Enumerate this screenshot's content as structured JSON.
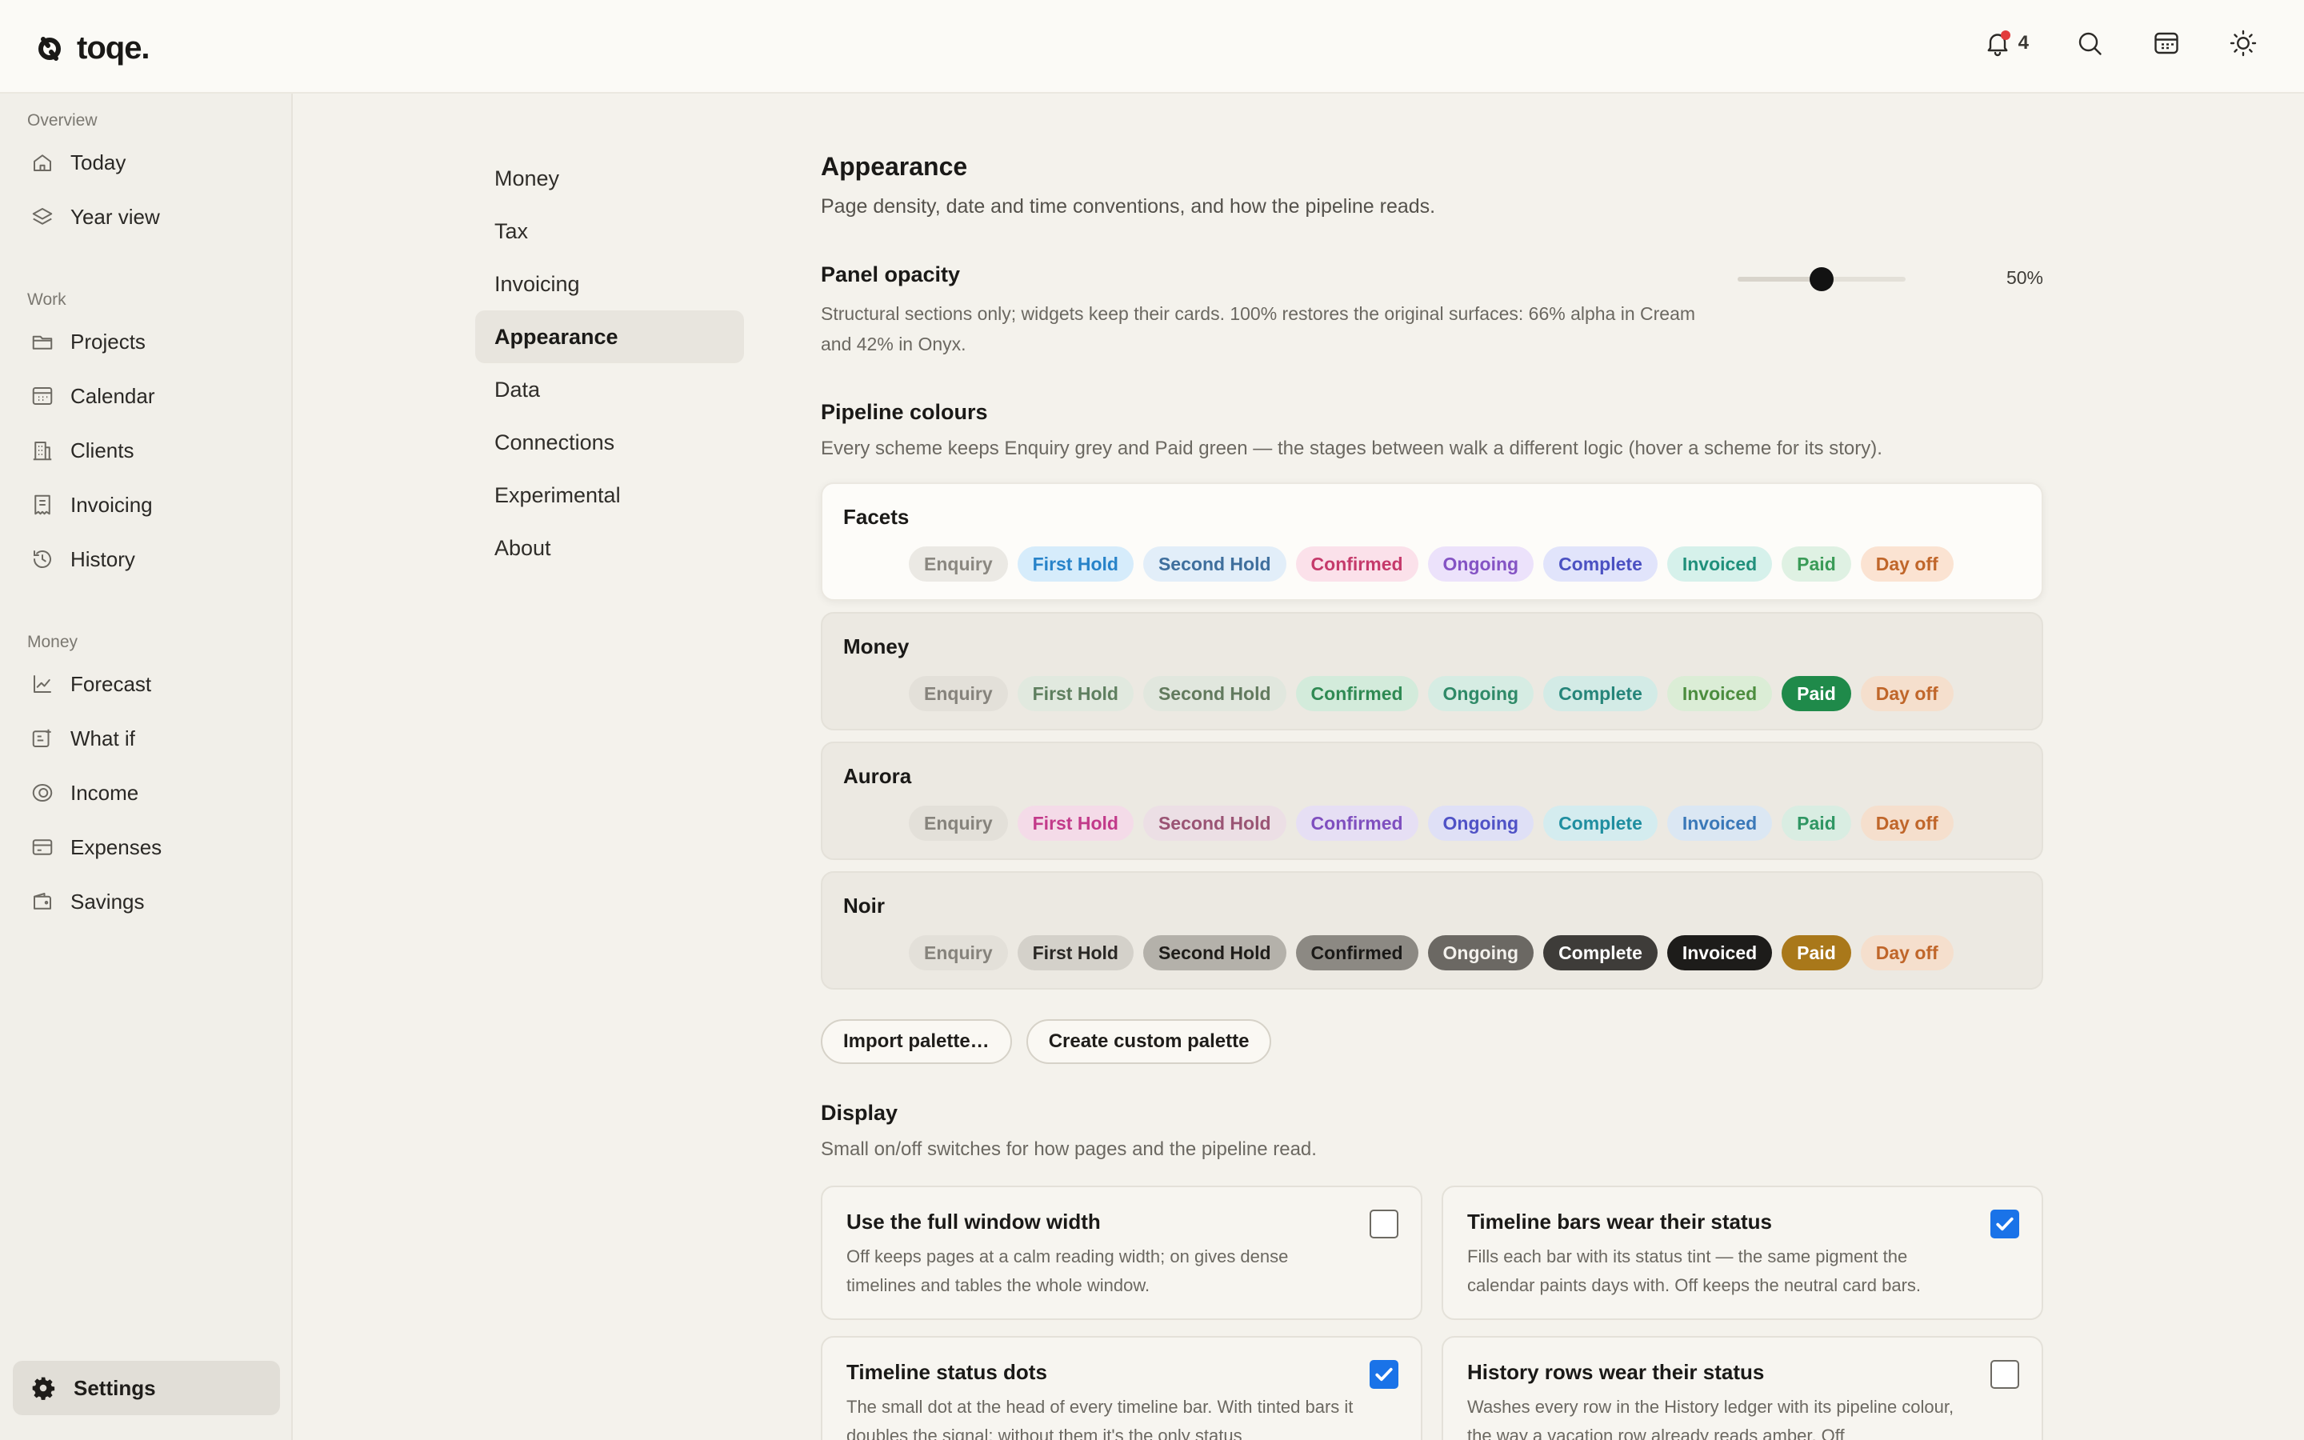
{
  "app": {
    "name": "toqe."
  },
  "topbar": {
    "notifications_count": "4"
  },
  "sidebar": {
    "sections": [
      {
        "heading": "Overview",
        "items": [
          {
            "label": "Today",
            "icon": "home-icon"
          },
          {
            "label": "Year view",
            "icon": "layers-icon"
          }
        ]
      },
      {
        "heading": "Work",
        "items": [
          {
            "label": "Projects",
            "icon": "folder-icon"
          },
          {
            "label": "Calendar",
            "icon": "calendar-icon"
          },
          {
            "label": "Clients",
            "icon": "building-icon"
          },
          {
            "label": "Invoicing",
            "icon": "invoice-icon"
          },
          {
            "label": "History",
            "icon": "history-icon"
          }
        ]
      },
      {
        "heading": "Money",
        "items": [
          {
            "label": "Forecast",
            "icon": "chart-line-icon"
          },
          {
            "label": "What if",
            "icon": "scenario-icon"
          },
          {
            "label": "Income",
            "icon": "coin-icon"
          },
          {
            "label": "Expenses",
            "icon": "card-icon"
          },
          {
            "label": "Savings",
            "icon": "wallet-icon"
          }
        ]
      }
    ],
    "settings_label": "Settings"
  },
  "subnav": {
    "items": [
      "Money",
      "Tax",
      "Invoicing",
      "Appearance",
      "Data",
      "Connections",
      "Experimental",
      "About"
    ],
    "active": "Appearance"
  },
  "appearance": {
    "title": "Appearance",
    "subtitle": "Page density, date and time conventions, and how the pipeline reads.",
    "opacity": {
      "label": "Panel opacity",
      "description": "Structural sections only; widgets keep their cards. 100% restores the original surfaces: 66% alpha in Cream and 42% in Onyx.",
      "value": 50,
      "value_label": "50%"
    },
    "pipeline": {
      "title": "Pipeline colours",
      "subtitle": "Every scheme keeps Enquiry grey and Paid green — the stages between walk a different logic (hover a scheme for its story).",
      "stages": [
        "Enquiry",
        "First Hold",
        "Second Hold",
        "Confirmed",
        "Ongoing",
        "Complete",
        "Invoiced",
        "Paid",
        "Day off"
      ],
      "schemes": [
        {
          "name": "Facets",
          "active": true,
          "chips": [
            {
              "bg": "#ebe9e4",
              "fg": "#8a8780"
            },
            {
              "bg": "#d6ecfb",
              "fg": "#2783c9"
            },
            {
              "bg": "#e2eef9",
              "fg": "#3f6f9d"
            },
            {
              "bg": "#fbe1ea",
              "fg": "#c53a6b"
            },
            {
              "bg": "#ece2fb",
              "fg": "#8453c4"
            },
            {
              "bg": "#e1e4fb",
              "fg": "#4b51c2"
            },
            {
              "bg": "#d6f1eb",
              "fg": "#20907b"
            },
            {
              "bg": "#dff1e3",
              "fg": "#3a9b57"
            },
            {
              "bg": "#fbe3d2",
              "fg": "#c0662a"
            }
          ]
        },
        {
          "name": "Money",
          "active": false,
          "chips": [
            {
              "bg": "#e3e0d9",
              "fg": "#86837c"
            },
            {
              "bg": "#e1e9df",
              "fg": "#5e7f5f"
            },
            {
              "bg": "#e1e7de",
              "fg": "#627a5e"
            },
            {
              "bg": "#d3ebdb",
              "fg": "#2f8a53"
            },
            {
              "bg": "#d6ece3",
              "fg": "#2f8a68"
            },
            {
              "bg": "#d3ebe6",
              "fg": "#26857a"
            },
            {
              "bg": "#dbedd6",
              "fg": "#4c8d3e"
            },
            {
              "bg": "#1f8a4a",
              "fg": "#ffffff"
            },
            {
              "bg": "#f5dfcd",
              "fg": "#c0662a"
            }
          ]
        },
        {
          "name": "Aurora",
          "active": false,
          "chips": [
            {
              "bg": "#e3e0d9",
              "fg": "#86837c"
            },
            {
              "bg": "#f4dbe8",
              "fg": "#c23a8a"
            },
            {
              "bg": "#ecdfe5",
              "fg": "#9a5474"
            },
            {
              "bg": "#e6dff4",
              "fg": "#7f4fbf"
            },
            {
              "bg": "#dfe0f6",
              "fg": "#4f52c6"
            },
            {
              "bg": "#d4ecef",
              "fg": "#1f8ea0"
            },
            {
              "bg": "#dbe7f3",
              "fg": "#3a78b8"
            },
            {
              "bg": "#d9ede2",
              "fg": "#2f9663"
            },
            {
              "bg": "#f5dfcd",
              "fg": "#c0662a"
            }
          ]
        },
        {
          "name": "Noir",
          "active": false,
          "chips": [
            {
              "bg": "#e3e0d9",
              "fg": "#86837c"
            },
            {
              "bg": "#d4d1ca",
              "fg": "#2a2825"
            },
            {
              "bg": "#b4b1aa",
              "fg": "#1f1d1a"
            },
            {
              "bg": "#8c8983",
              "fg": "#1a1917"
            },
            {
              "bg": "#6b6863",
              "fg": "#f3f1ec"
            },
            {
              "bg": "#3e3c39",
              "fg": "#ffffff"
            },
            {
              "bg": "#1d1c1a",
              "fg": "#ffffff"
            },
            {
              "bg": "#a9781a",
              "fg": "#ffffff"
            },
            {
              "bg": "#f5dfcd",
              "fg": "#c0662a"
            }
          ]
        }
      ]
    },
    "actions": {
      "import": "Import palette…",
      "create": "Create custom palette"
    },
    "display": {
      "title": "Display",
      "subtitle": "Small on/off switches for how pages and the pipeline read.",
      "cards": [
        {
          "title": "Use the full window width",
          "desc": "Off keeps pages at a calm reading width; on gives dense timelines and tables the whole window.",
          "checked": false
        },
        {
          "title": "Timeline bars wear their status",
          "desc": "Fills each bar with its status tint — the same pigment the calendar paints days with. Off keeps the neutral card bars.",
          "checked": true
        },
        {
          "title": "Timeline status dots",
          "desc": "The small dot at the head of every timeline bar. With tinted bars it doubles the signal; without them it's the only status",
          "checked": true
        },
        {
          "title": "History rows wear their status",
          "desc": "Washes every row in the History ledger with its pipeline colour, the way a vacation row already reads amber. Off",
          "checked": false
        }
      ]
    }
  },
  "colors": {
    "accent": "#1a73e8",
    "notification_dot": "#e23b3b"
  }
}
